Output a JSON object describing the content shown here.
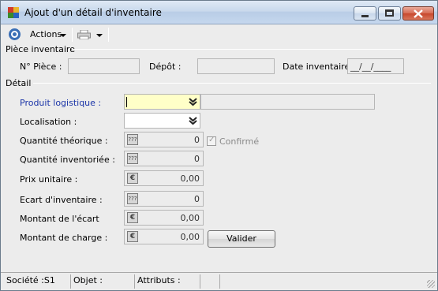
{
  "window": {
    "title": "Ajout d'un détail d'inventaire",
    "icon": "app-icon",
    "controls": [
      "minimize-icon",
      "maximize-icon",
      "close-icon"
    ]
  },
  "toolbar": {
    "actions_label": "Actions",
    "print_icon": "printer-icon"
  },
  "piece_inventaire": {
    "section_title": "Pièce inventaire",
    "numero_label": "N° Pièce :",
    "numero_value": "",
    "depot_label": "Dépôt :",
    "depot_value": "",
    "date_label": "Date inventaire :",
    "date_value": "__/__/____"
  },
  "detail": {
    "section_title": "Détail",
    "produit_label": "Produit logistique :",
    "produit_value": "",
    "localisation_label": "Localisation :",
    "localisation_value": "",
    "qte_theorique_label": "Quantité théorique :",
    "qte_theorique_value": "0",
    "confirme_label": "Confirmé",
    "confirme_checked": true,
    "qte_inventoriee_label": "Quantité inventoriée :",
    "qte_inventoriee_value": "0",
    "prix_unitaire_label": "Prix unitaire :",
    "prix_unitaire_value": "0,00",
    "ecart_label": "Ecart d'inventaire :",
    "ecart_value": "0",
    "montant_ecart_label": "Montant de l'écart",
    "montant_ecart_value": "0,00",
    "montant_charge_label": "Montant de charge :",
    "montant_charge_value": "0,00",
    "valider_label": "Valider"
  },
  "status": {
    "societe": "Société :S1",
    "objet": "Objet :",
    "attributs": "Attributs :"
  },
  "colors": {
    "title_gradient": "#c9d9ec",
    "required_label": "#1b35a8",
    "yellow_field": "#ffffc8",
    "background": "#ececec"
  }
}
